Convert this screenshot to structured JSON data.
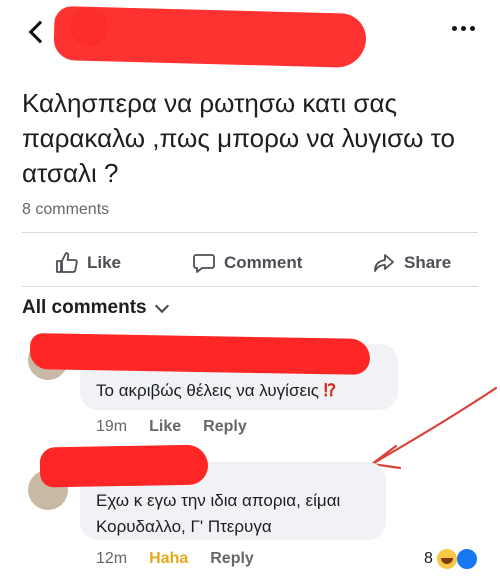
{
  "header": {
    "back_icon": "chevron-left-icon",
    "more_icon": "more-horizontal-icon"
  },
  "post": {
    "text": "Καλησπερα να ρωτησω κατι σας παρακαλω ,πως μπορω να λυγισω το ατσαλι ?",
    "comment_count": "8 comments"
  },
  "actions": {
    "like": "Like",
    "comment": "Comment",
    "share": "Share"
  },
  "comments_header": "All comments",
  "comments": [
    {
      "text": "Το ακριβώς θέλεις να λυγίσεις ",
      "emphasis": "⁉",
      "time": "19m",
      "like": "Like",
      "reply": "Reply"
    },
    {
      "line1": "Εχω κ εγω την ιδια απορια, είμαι",
      "line2": "Κορυδαλλο, Γ' Πτερυγα",
      "time": "12m",
      "reaction": "Haha",
      "reply": "Reply",
      "reaction_count": "8"
    }
  ],
  "colors": {
    "redaction": "#ff2b2b",
    "bubble": "#f0f2f5",
    "haha": "#e6a91c",
    "arrow": "#d9413a"
  }
}
